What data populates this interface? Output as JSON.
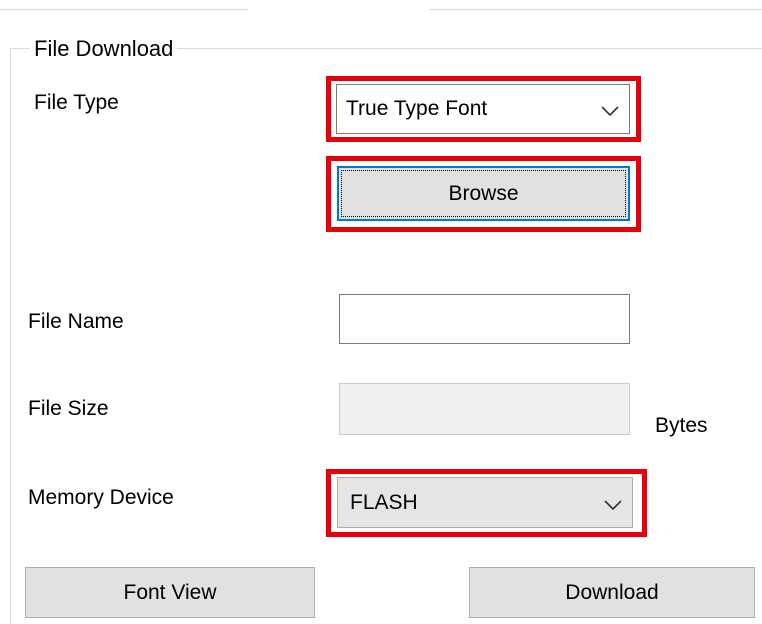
{
  "group": {
    "title": "File Download"
  },
  "file_type": {
    "label": "File Type",
    "selected": "True Type Font"
  },
  "browse": {
    "label": "Browse"
  },
  "file_name": {
    "label": "File Name",
    "value": ""
  },
  "file_size": {
    "label": "File Size",
    "value": "",
    "unit": "Bytes"
  },
  "memory_device": {
    "label": "Memory Device",
    "selected": "FLASH"
  },
  "actions": {
    "font_view_label": "Font View",
    "download_label": "Download"
  },
  "colors": {
    "highlight": "#e5000b",
    "focus": "#0078d7",
    "button_face": "#e1e1e1"
  },
  "icons": {
    "dropdown": "chevron-down-icon"
  }
}
